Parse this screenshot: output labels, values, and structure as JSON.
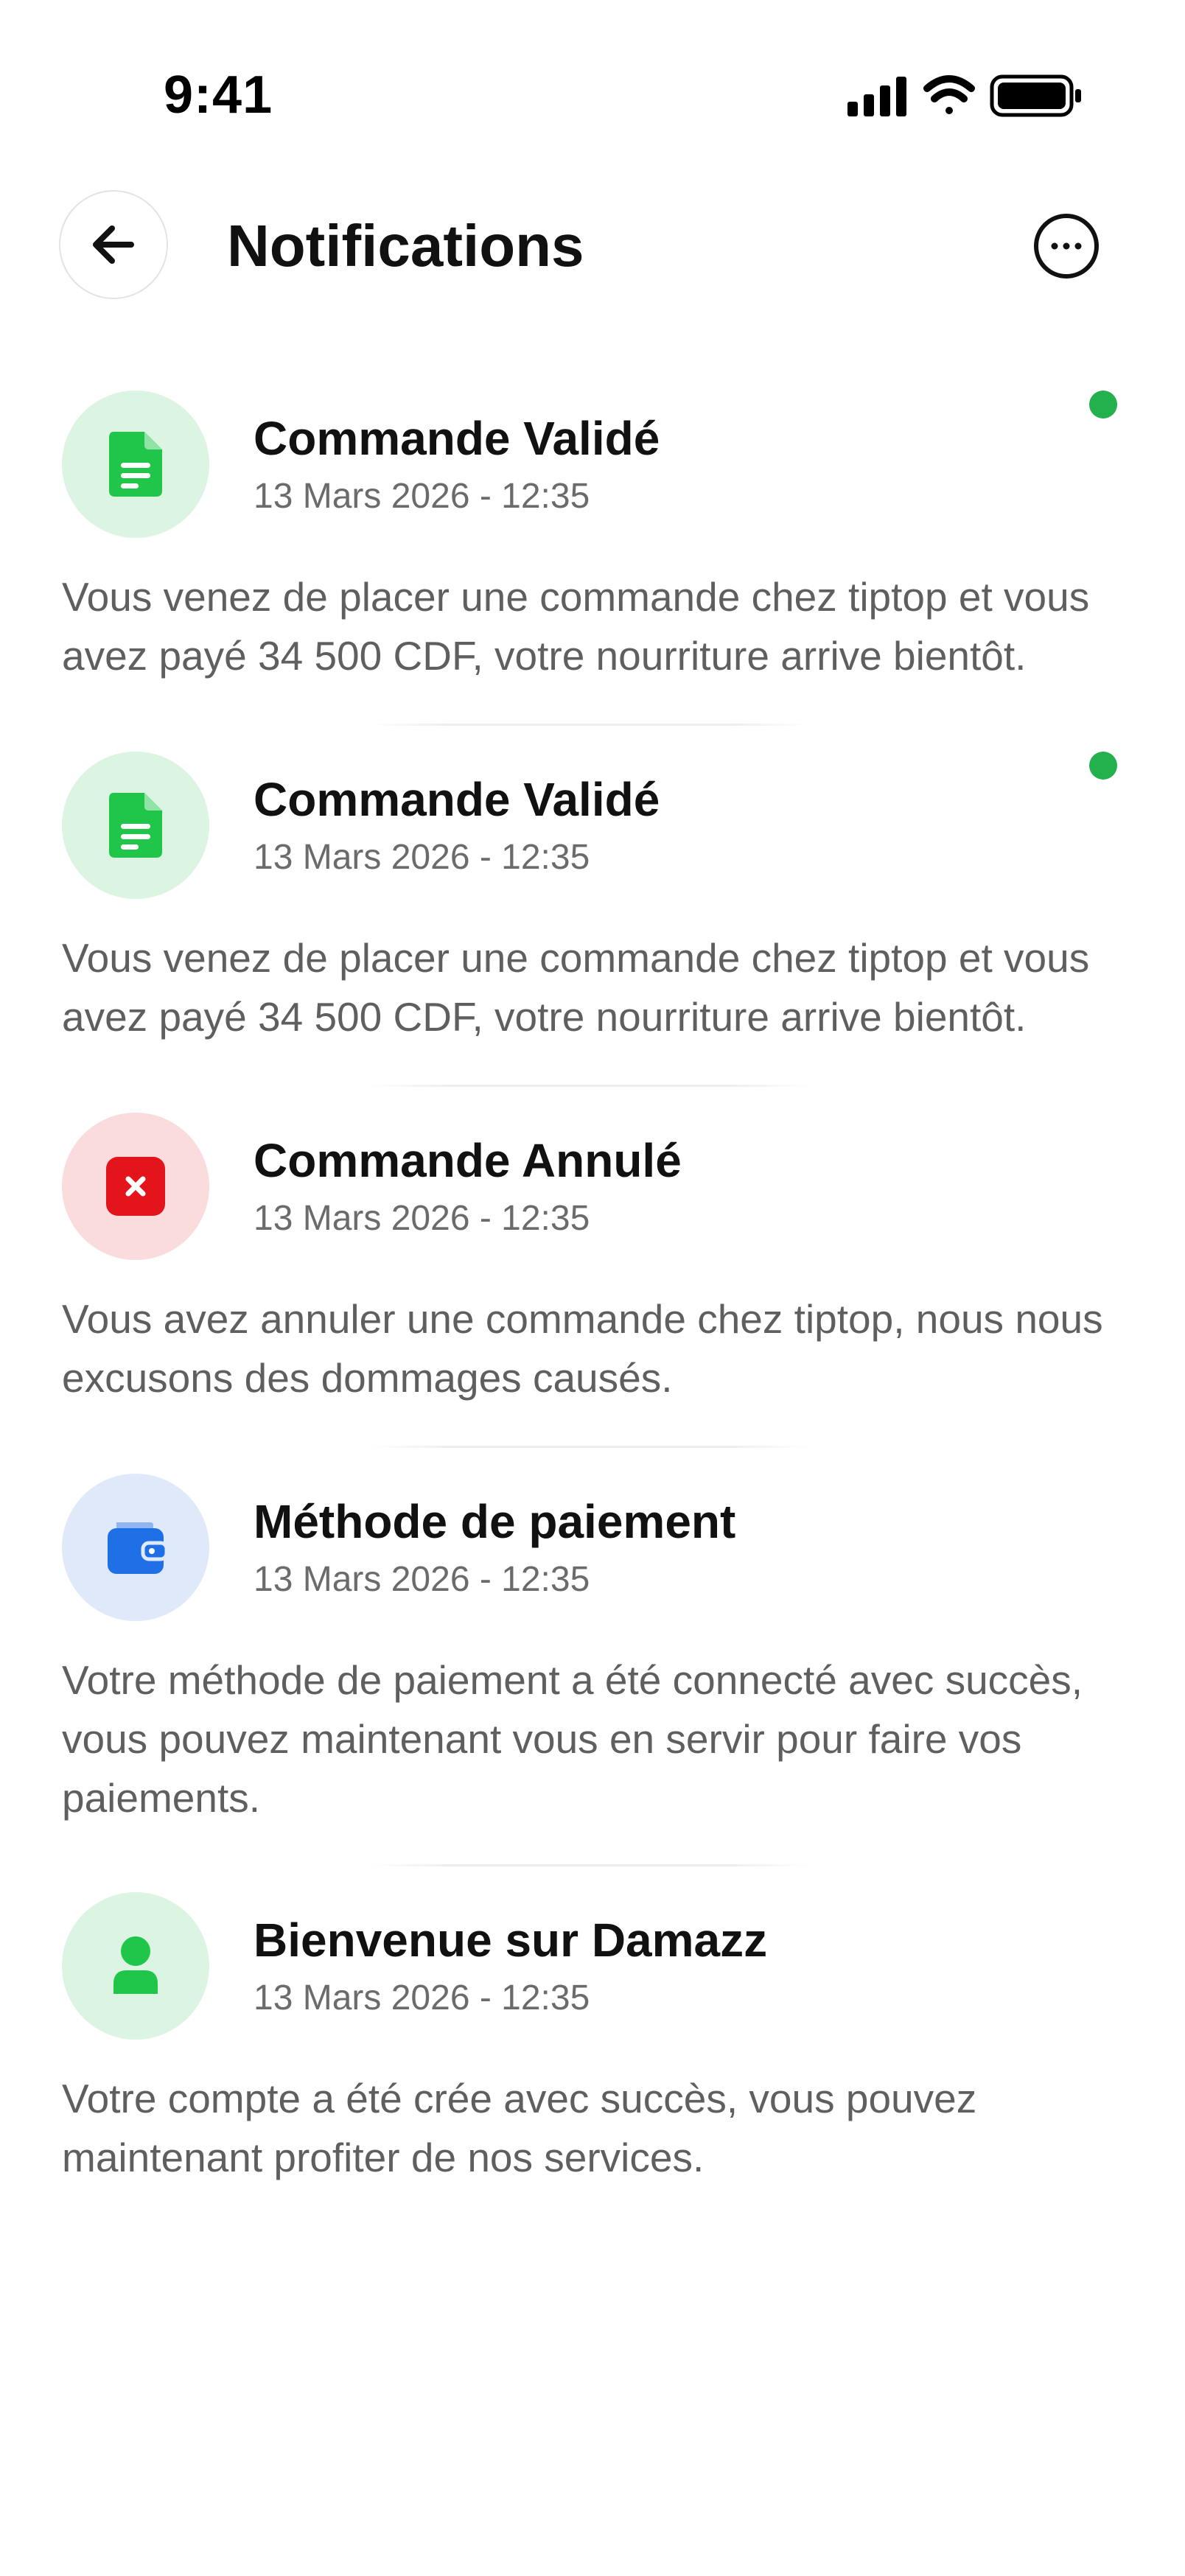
{
  "status_bar": {
    "time": "9:41",
    "icons": [
      "signal-icon",
      "wifi-icon",
      "battery-icon"
    ]
  },
  "header": {
    "title": "Notifications",
    "back_icon": "arrow-left-icon",
    "more_icon": "more-horizontal-icon"
  },
  "colors": {
    "unread_dot": "#22b14c",
    "success_bg": "#dcf5e2",
    "success_fg": "#1fc64a",
    "error_bg": "#fadcdc",
    "error_fg": "#e3141b",
    "info_bg": "#dfe9fa",
    "info_fg": "#1f6fe6"
  },
  "notifications": [
    {
      "icon": "document-icon",
      "tone": "success",
      "unread": true,
      "title": "Commande Validé",
      "date": "13 Mars 2026 - 12:35",
      "body": "Vous venez de placer une commande chez tiptop et vous avez payé 34 500 CDF, votre nourriture arrive bientôt."
    },
    {
      "icon": "document-icon",
      "tone": "success",
      "unread": true,
      "title": "Commande Validé",
      "date": "13 Mars 2026 - 12:35",
      "body": "Vous venez de placer une commande chez tiptop et vous avez payé 34 500 CDF, votre nourriture arrive bientôt."
    },
    {
      "icon": "close-square-icon",
      "tone": "error",
      "unread": false,
      "title": "Commande Annulé",
      "date": "13 Mars 2026 - 12:35",
      "body": "Vous avez annuler une commande chez tiptop, nous nous excusons des dommages causés."
    },
    {
      "icon": "wallet-icon",
      "tone": "info",
      "unread": false,
      "title": "Méthode de paiement",
      "date": "13 Mars 2026 - 12:35",
      "body": "Votre méthode de paiement a été connecté avec succès, vous pouvez maintenant vous en servir pour faire vos paiements."
    },
    {
      "icon": "user-icon",
      "tone": "success",
      "unread": false,
      "title": "Bienvenue sur Damazz",
      "date": "13 Mars 2026 - 12:35",
      "body": "Votre compte a été crée avec succès, vous pouvez maintenant profiter de nos services."
    }
  ]
}
